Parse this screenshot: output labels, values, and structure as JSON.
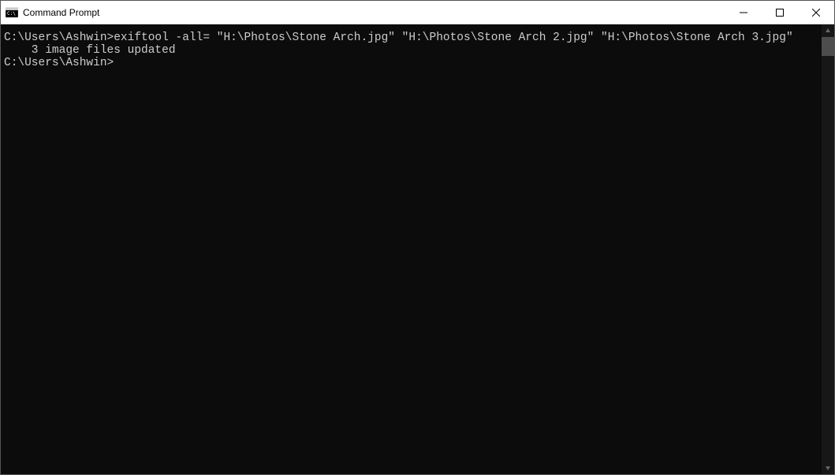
{
  "window": {
    "title": "Command Prompt"
  },
  "terminal": {
    "line1": "C:\\Users\\Ashwin>exiftool -all= \"H:\\Photos\\Stone Arch.jpg\" \"H:\\Photos\\Stone Arch 2.jpg\" \"H:\\Photos\\Stone Arch 3.jpg\"",
    "line2": "    3 image files updated",
    "line3": "",
    "line4": "C:\\Users\\Ashwin>"
  }
}
